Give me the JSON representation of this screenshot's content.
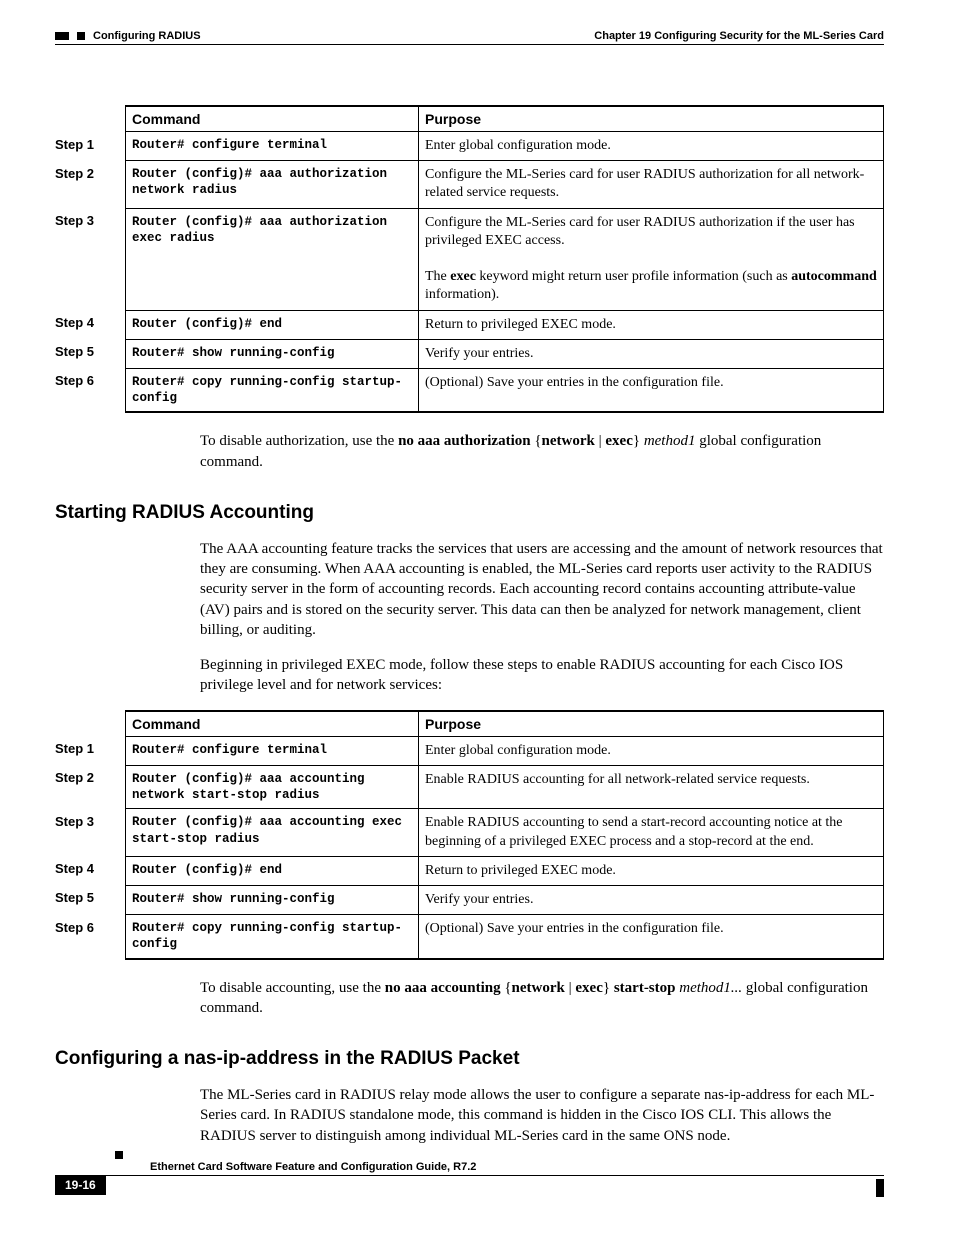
{
  "header": {
    "chapter": "Chapter 19  Configuring Security for the ML-Series Card",
    "section": "Configuring RADIUS"
  },
  "table1": {
    "col_command": "Command",
    "col_purpose": "Purpose",
    "rows": [
      {
        "step": "Step 1",
        "cmd": "Router# configure terminal",
        "purp": "Enter global configuration mode."
      },
      {
        "step": "Step 2",
        "cmd": "Router (config)# aaa authorization network radius",
        "purp": "Configure the ML-Series card for user RADIUS authorization for all network-related service requests."
      },
      {
        "step": "Step 3",
        "cmd": "Router (config)# aaa authorization exec radius",
        "purp_html": "Configure the ML-Series card for user RADIUS authorization if the user has privileged EXEC access.<br><br>The <b>exec</b> keyword might return user profile information (such as <b>autocommand</b> information)."
      },
      {
        "step": "Step 4",
        "cmd": "Router (config)# end",
        "purp": "Return to privileged EXEC mode."
      },
      {
        "step": "Step 5",
        "cmd": "Router# show running-config",
        "purp": "Verify your entries."
      },
      {
        "step": "Step 6",
        "cmd": "Router# copy running-config startup-config",
        "purp": "(Optional) Save your entries in the configuration file."
      }
    ]
  },
  "para1_html": "To disable authorization, use the <b>no aaa authorization</b> {<b>network</b> | <b>exec</b>} <i>method1</i> global configuration command.",
  "h2a": "Starting RADIUS Accounting",
  "para2": "The AAA accounting feature tracks the services that users are accessing and the amount of network resources that they are consuming. When AAA accounting is enabled, the ML-Series card reports user activity to the RADIUS security server in the form of accounting records. Each accounting record contains accounting attribute-value (AV) pairs and is stored on the security server. This data can then be analyzed for network management, client billing, or auditing.",
  "para3": "Beginning in privileged EXEC mode, follow these steps to enable RADIUS accounting for each Cisco IOS privilege level and for network services:",
  "table2": {
    "col_command": "Command",
    "col_purpose": "Purpose",
    "rows": [
      {
        "step": "Step 1",
        "cmd": "Router# configure terminal",
        "purp": "Enter global configuration mode."
      },
      {
        "step": "Step 2",
        "cmd": "Router (config)# aaa accounting network start-stop radius",
        "purp": "Enable RADIUS accounting for all network-related service requests."
      },
      {
        "step": "Step 3",
        "cmd": "Router (config)# aaa accounting exec start-stop radius",
        "purp": "Enable RADIUS accounting to send a start-record accounting notice at the beginning of a privileged EXEC process and a stop-record at the end."
      },
      {
        "step": "Step 4",
        "cmd": "Router (config)# end",
        "purp": "Return to privileged EXEC mode."
      },
      {
        "step": "Step 5",
        "cmd": "Router# show running-config",
        "purp": "Verify your entries."
      },
      {
        "step": "Step 6",
        "cmd": "Router# copy running-config startup-config",
        "purp": "(Optional) Save your entries in the configuration file."
      }
    ]
  },
  "para4_html": "To disable accounting, use the <b>no aaa accounting</b> {<b>network</b> | <b>exec</b>} <b>start-stop</b> <i>method1...</i> global configuration command.",
  "h2b": "Configuring a nas-ip-address in the RADIUS Packet",
  "para5": "The ML-Series card in RADIUS relay mode allows the user to configure a separate nas-ip-address for each ML-Series card. In RADIUS standalone mode, this command is hidden in the Cisco IOS CLI. This allows the RADIUS server to distinguish among individual ML-Series card in the same ONS node.",
  "footer": {
    "title": "Ethernet Card Software Feature and Configuration Guide, R7.2",
    "page": "19-16"
  }
}
